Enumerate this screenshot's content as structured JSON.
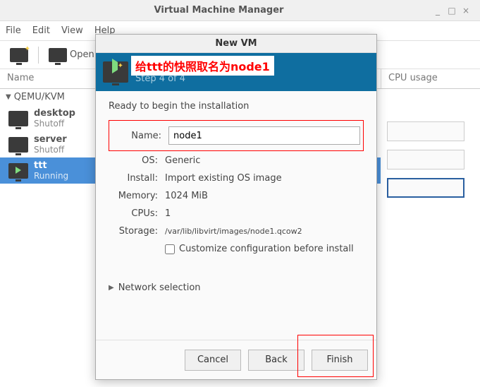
{
  "window": {
    "title": "Virtual Machine Manager",
    "minimize": "_",
    "maximize": "□",
    "close": "×"
  },
  "menubar": {
    "file": "File",
    "edit": "Edit",
    "view": "View",
    "help": "Help"
  },
  "toolbar": {
    "new_label": "",
    "open_label": "Open"
  },
  "headers": {
    "name": "Name",
    "cpu": "CPU usage"
  },
  "tree": {
    "group": "QEMU/KVM",
    "vms": [
      {
        "name": "desktop",
        "state": "Shutoff",
        "selected": false,
        "running": false
      },
      {
        "name": "server",
        "state": "Shutoff",
        "selected": false,
        "running": false
      },
      {
        "name": "ttt",
        "state": "Running",
        "selected": true,
        "running": true
      }
    ]
  },
  "dialog": {
    "title": "New VM",
    "step": "Step 4 of 4",
    "annotation": "给ttt的快照取名为node1",
    "intro": "Ready to begin the installation",
    "fields": {
      "name_label": "Name:",
      "name_value": "node1",
      "os_label": "OS:",
      "os_value": "Generic",
      "install_label": "Install:",
      "install_value": "Import existing OS image",
      "memory_label": "Memory:",
      "memory_value": "1024 MiB",
      "cpus_label": "CPUs:",
      "cpus_value": "1",
      "storage_label": "Storage:",
      "storage_value": "/var/lib/libvirt/images/node1.qcow2"
    },
    "customize_label": "Customize configuration before install",
    "network_label": "Network selection",
    "buttons": {
      "cancel": "Cancel",
      "back": "Back",
      "finish": "Finish"
    }
  }
}
